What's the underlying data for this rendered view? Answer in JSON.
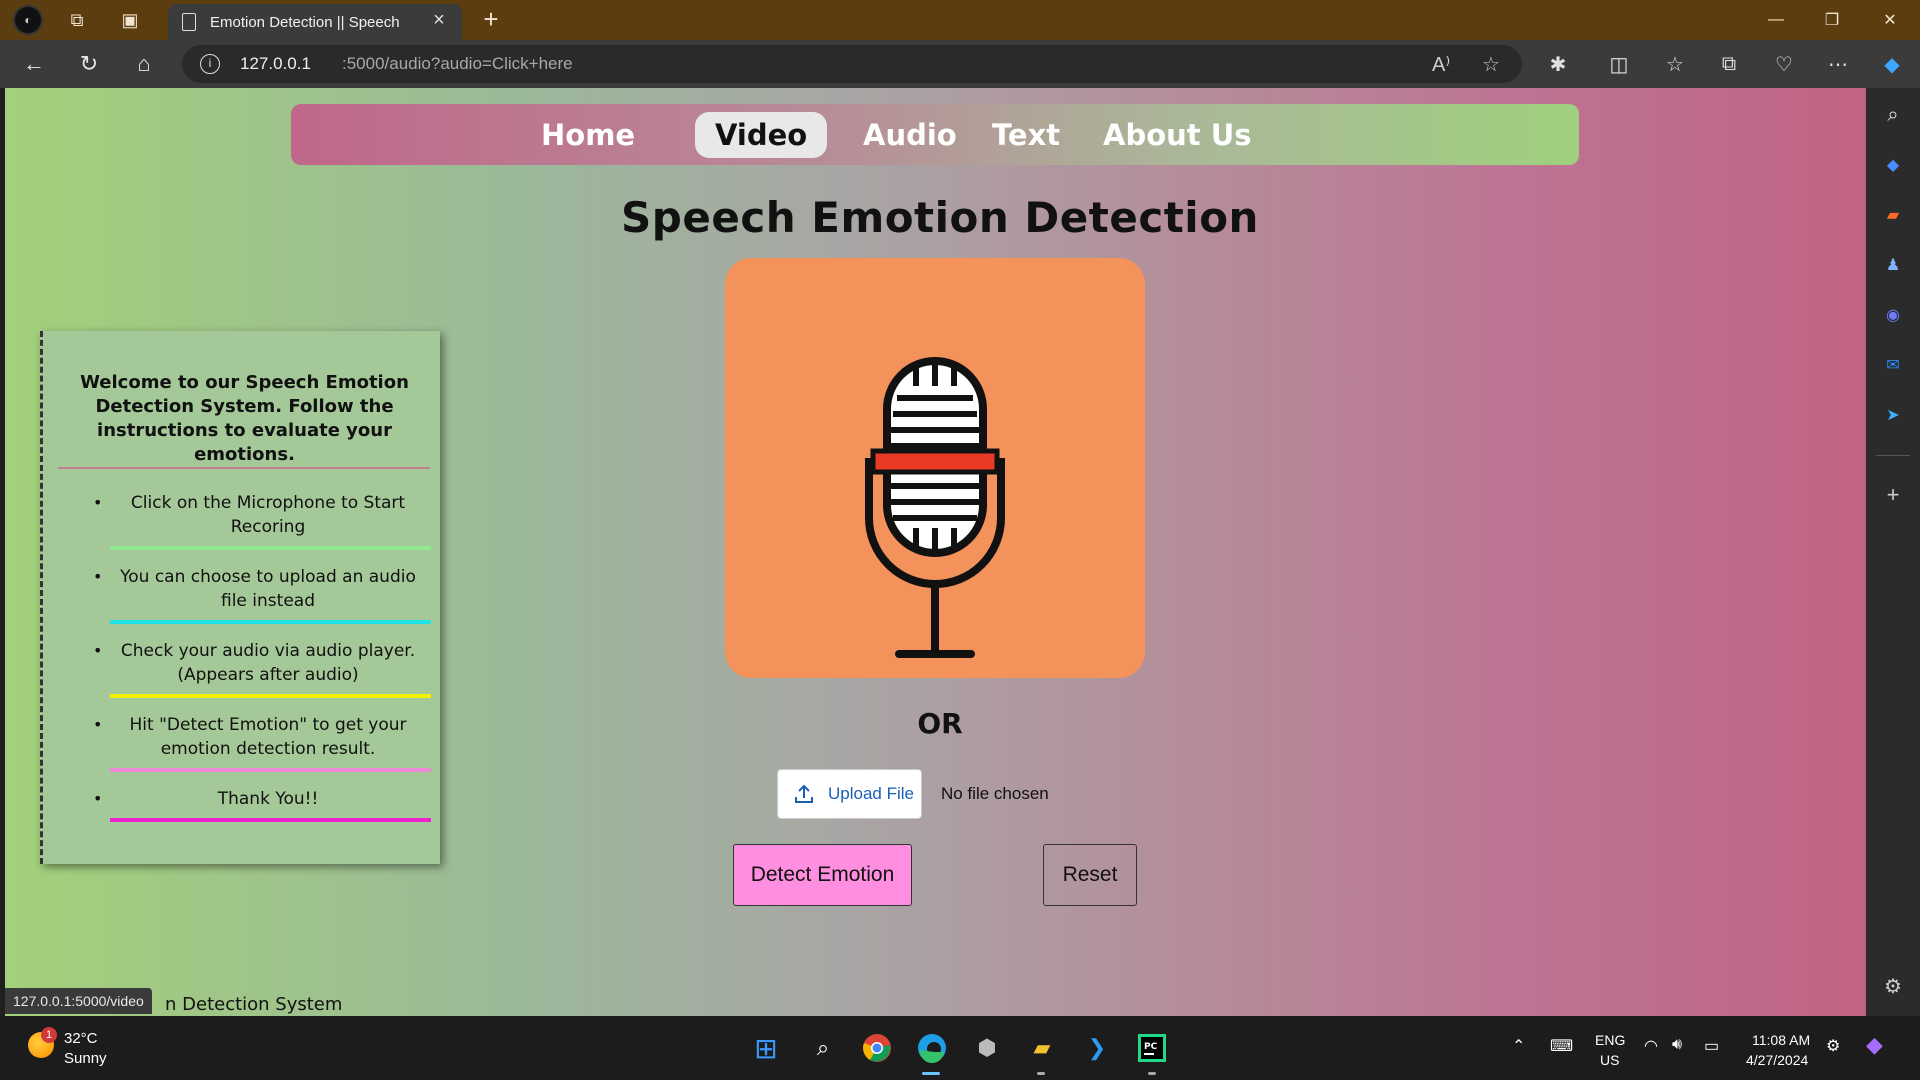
{
  "browser": {
    "tab_title": "Emotion Detection || Speech",
    "url_host": "127.0.0.1",
    "url_rest": ":5000/audio?audio=Click+here",
    "status_url": "127.0.0.1:5000/video"
  },
  "nav": {
    "items": [
      "Home",
      "Video",
      "Audio",
      "Text",
      "About Us"
    ],
    "active": "Video"
  },
  "main": {
    "title": "Speech Emotion Detection",
    "or_text": "OR",
    "upload_label": "Upload File",
    "file_status": "No file chosen",
    "detect_label": "Detect Emotion",
    "reset_label": "Reset"
  },
  "instructions": {
    "welcome": "Welcome to our Speech Emotion Detection System. Follow the instructions to evaluate your emotions.",
    "items": [
      {
        "text": "Click on the Microphone to Start Recoring",
        "line_color": "#90e890"
      },
      {
        "text": "You can choose to upload an audio file instead",
        "line_color": "#22e0e8"
      },
      {
        "text": "Check your audio via audio player. (Appears after audio)",
        "line_color": "#f2f200"
      },
      {
        "text": "Hit \"Detect Emotion\" to get your emotion detection result.",
        "line_color": "#f08ad8"
      },
      {
        "text": "Thank You!!",
        "line_color": "#ee22cc"
      }
    ]
  },
  "footer": {
    "text": "n Detection System"
  },
  "taskbar": {
    "weather_temp": "32°C",
    "weather_desc": "Sunny",
    "weather_badge": "1",
    "lang_top": "ENG",
    "lang_bottom": "US",
    "time": "11:08 AM",
    "date": "4/27/2024"
  },
  "colors": {
    "mic_box": "#f4925c",
    "detect_button": "#ff8ee0",
    "titlebar": "#5c3d10"
  }
}
